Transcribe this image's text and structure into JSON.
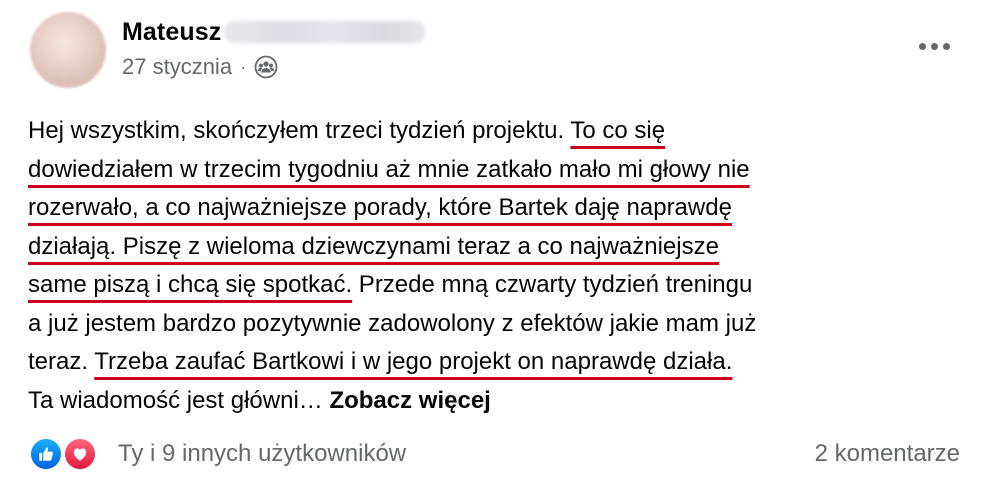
{
  "post": {
    "author": {
      "name": "Mateusz",
      "avatar": "blurred-profile-photo"
    },
    "date": "27 stycznia",
    "separator": "·",
    "audience_icon": "friends-icon",
    "more_icon": "more-options-icon",
    "text_lines": [
      [
        {
          "text": "Hej wszystkim, skończyłem trzeci tydzień projektu. "
        },
        {
          "text": "To co się",
          "underline": true
        }
      ],
      [
        {
          "text": "dowiedziałem w trzecim tygodniu aż mnie zatkało mało mi głowy nie",
          "underline": true
        }
      ],
      [
        {
          "text": "rozerwało, a co najważniejsze porady, które Bartek daję naprawdę",
          "underline": true
        }
      ],
      [
        {
          "text": "działają. Piszę z wieloma dziewczynami teraz a co najważniejsze",
          "underline": true
        }
      ],
      [
        {
          "text": "same piszą i chcą się spotkać.",
          "underline": true
        },
        {
          "text": " Przede mną czwarty tydzień treningu"
        }
      ],
      [
        {
          "text": "a już jestem bardzo pozytywnie zadowolony z efektów jakie mam już"
        }
      ],
      [
        {
          "text": "teraz. "
        },
        {
          "text": "Trzeba zaufać Bartkowi i w jego projekt on naprawdę działa.",
          "underline": true
        }
      ],
      [
        {
          "text": "Ta wiadomość jest główni… "
        }
      ]
    ],
    "see_more": "Zobacz więcej",
    "underline_color": "#d0021b",
    "reactions": {
      "icons": [
        "like-icon",
        "love-icon"
      ],
      "text": "Ty i 9 innych użytkowników"
    },
    "comments": "2 komentarze"
  }
}
